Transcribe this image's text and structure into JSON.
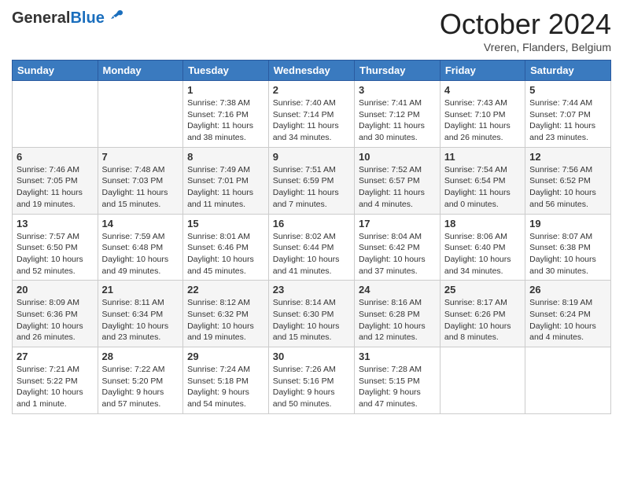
{
  "header": {
    "logo_general": "General",
    "logo_blue": "Blue",
    "month_title": "October 2024",
    "location": "Vreren, Flanders, Belgium"
  },
  "calendar": {
    "days_of_week": [
      "Sunday",
      "Monday",
      "Tuesday",
      "Wednesday",
      "Thursday",
      "Friday",
      "Saturday"
    ],
    "weeks": [
      [
        {
          "day": "",
          "info": ""
        },
        {
          "day": "",
          "info": ""
        },
        {
          "day": "1",
          "info": "Sunrise: 7:38 AM\nSunset: 7:16 PM\nDaylight: 11 hours and 38 minutes."
        },
        {
          "day": "2",
          "info": "Sunrise: 7:40 AM\nSunset: 7:14 PM\nDaylight: 11 hours and 34 minutes."
        },
        {
          "day": "3",
          "info": "Sunrise: 7:41 AM\nSunset: 7:12 PM\nDaylight: 11 hours and 30 minutes."
        },
        {
          "day": "4",
          "info": "Sunrise: 7:43 AM\nSunset: 7:10 PM\nDaylight: 11 hours and 26 minutes."
        },
        {
          "day": "5",
          "info": "Sunrise: 7:44 AM\nSunset: 7:07 PM\nDaylight: 11 hours and 23 minutes."
        }
      ],
      [
        {
          "day": "6",
          "info": "Sunrise: 7:46 AM\nSunset: 7:05 PM\nDaylight: 11 hours and 19 minutes."
        },
        {
          "day": "7",
          "info": "Sunrise: 7:48 AM\nSunset: 7:03 PM\nDaylight: 11 hours and 15 minutes."
        },
        {
          "day": "8",
          "info": "Sunrise: 7:49 AM\nSunset: 7:01 PM\nDaylight: 11 hours and 11 minutes."
        },
        {
          "day": "9",
          "info": "Sunrise: 7:51 AM\nSunset: 6:59 PM\nDaylight: 11 hours and 7 minutes."
        },
        {
          "day": "10",
          "info": "Sunrise: 7:52 AM\nSunset: 6:57 PM\nDaylight: 11 hours and 4 minutes."
        },
        {
          "day": "11",
          "info": "Sunrise: 7:54 AM\nSunset: 6:54 PM\nDaylight: 11 hours and 0 minutes."
        },
        {
          "day": "12",
          "info": "Sunrise: 7:56 AM\nSunset: 6:52 PM\nDaylight: 10 hours and 56 minutes."
        }
      ],
      [
        {
          "day": "13",
          "info": "Sunrise: 7:57 AM\nSunset: 6:50 PM\nDaylight: 10 hours and 52 minutes."
        },
        {
          "day": "14",
          "info": "Sunrise: 7:59 AM\nSunset: 6:48 PM\nDaylight: 10 hours and 49 minutes."
        },
        {
          "day": "15",
          "info": "Sunrise: 8:01 AM\nSunset: 6:46 PM\nDaylight: 10 hours and 45 minutes."
        },
        {
          "day": "16",
          "info": "Sunrise: 8:02 AM\nSunset: 6:44 PM\nDaylight: 10 hours and 41 minutes."
        },
        {
          "day": "17",
          "info": "Sunrise: 8:04 AM\nSunset: 6:42 PM\nDaylight: 10 hours and 37 minutes."
        },
        {
          "day": "18",
          "info": "Sunrise: 8:06 AM\nSunset: 6:40 PM\nDaylight: 10 hours and 34 minutes."
        },
        {
          "day": "19",
          "info": "Sunrise: 8:07 AM\nSunset: 6:38 PM\nDaylight: 10 hours and 30 minutes."
        }
      ],
      [
        {
          "day": "20",
          "info": "Sunrise: 8:09 AM\nSunset: 6:36 PM\nDaylight: 10 hours and 26 minutes."
        },
        {
          "day": "21",
          "info": "Sunrise: 8:11 AM\nSunset: 6:34 PM\nDaylight: 10 hours and 23 minutes."
        },
        {
          "day": "22",
          "info": "Sunrise: 8:12 AM\nSunset: 6:32 PM\nDaylight: 10 hours and 19 minutes."
        },
        {
          "day": "23",
          "info": "Sunrise: 8:14 AM\nSunset: 6:30 PM\nDaylight: 10 hours and 15 minutes."
        },
        {
          "day": "24",
          "info": "Sunrise: 8:16 AM\nSunset: 6:28 PM\nDaylight: 10 hours and 12 minutes."
        },
        {
          "day": "25",
          "info": "Sunrise: 8:17 AM\nSunset: 6:26 PM\nDaylight: 10 hours and 8 minutes."
        },
        {
          "day": "26",
          "info": "Sunrise: 8:19 AM\nSunset: 6:24 PM\nDaylight: 10 hours and 4 minutes."
        }
      ],
      [
        {
          "day": "27",
          "info": "Sunrise: 7:21 AM\nSunset: 5:22 PM\nDaylight: 10 hours and 1 minute."
        },
        {
          "day": "28",
          "info": "Sunrise: 7:22 AM\nSunset: 5:20 PM\nDaylight: 9 hours and 57 minutes."
        },
        {
          "day": "29",
          "info": "Sunrise: 7:24 AM\nSunset: 5:18 PM\nDaylight: 9 hours and 54 minutes."
        },
        {
          "day": "30",
          "info": "Sunrise: 7:26 AM\nSunset: 5:16 PM\nDaylight: 9 hours and 50 minutes."
        },
        {
          "day": "31",
          "info": "Sunrise: 7:28 AM\nSunset: 5:15 PM\nDaylight: 9 hours and 47 minutes."
        },
        {
          "day": "",
          "info": ""
        },
        {
          "day": "",
          "info": ""
        }
      ]
    ]
  }
}
